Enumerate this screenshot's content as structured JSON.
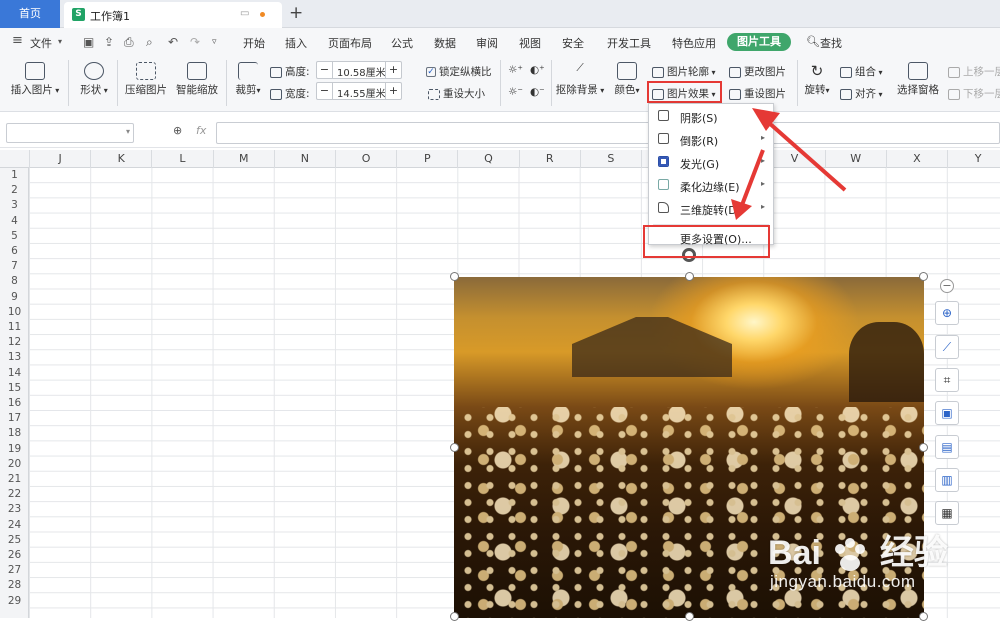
{
  "tabs": {
    "home": "首页",
    "doc_title": "工作簿1"
  },
  "menubar": {
    "file": "文件",
    "items": [
      "开始",
      "插入",
      "页面布局",
      "公式",
      "数据",
      "审阅",
      "视图",
      "安全",
      "开发工具",
      "特色应用"
    ],
    "pic_tools": "图片工具",
    "search": "查找"
  },
  "ribbon": {
    "insert_pic": "插入图片",
    "shape": "形状",
    "compress": "压缩图片",
    "smart_zoom": "智能缩放",
    "crop": "裁剪",
    "height_label": "高度:",
    "height_val": "10.58厘米",
    "width_label": "宽度:",
    "width_val": "14.55厘米",
    "lock_ratio": "锁定纵横比",
    "reset_size": "重设大小",
    "remove_bg": "抠除背景",
    "color": "颜色",
    "pic_outline": "图片轮廓",
    "pic_effect": "图片效果",
    "change_pic": "更改图片",
    "reset_pic": "重设图片",
    "rotate": "旋转",
    "group": "组合",
    "align": "对齐",
    "select_pane": "选择窗格",
    "bring_up": "上移一层",
    "send_down": "下移一层"
  },
  "formulabar": {
    "fx": "fx"
  },
  "columns": [
    "J",
    "K",
    "L",
    "M",
    "N",
    "O",
    "P",
    "Q",
    "R",
    "S",
    "T",
    "U",
    "V",
    "W",
    "X",
    "Y"
  ],
  "rows": [
    "1",
    "2",
    "3",
    "4",
    "5",
    "6",
    "7",
    "8",
    "9",
    "10",
    "11",
    "12",
    "13",
    "14",
    "15",
    "16",
    "17",
    "18",
    "19",
    "20",
    "21",
    "22",
    "23",
    "24",
    "25",
    "26",
    "27",
    "28",
    "29"
  ],
  "effect_menu": {
    "items": [
      {
        "label": "阴影(S)",
        "sub": true
      },
      {
        "label": "倒影(R)",
        "sub": true
      },
      {
        "label": "发光(G)",
        "sub": true
      },
      {
        "label": "柔化边缘(E)",
        "sub": true
      },
      {
        "label": "三维旋转(D)",
        "sub": true
      }
    ],
    "more": "更多设置(O)..."
  },
  "watermark": {
    "brand": "Bai",
    "brand_cn": "经验",
    "url": "jingyan.baidu.com"
  },
  "accent": {
    "highlight": "#e53935",
    "tools": "#3fa66b",
    "home_tab": "#3a78d8"
  }
}
